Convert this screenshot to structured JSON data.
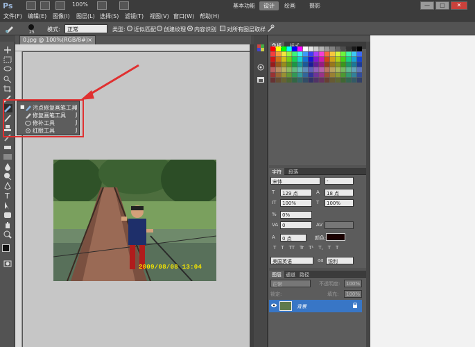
{
  "app": {
    "logo": "Ps"
  },
  "menubar": {
    "zoom": "100%",
    "workspaces": [
      "基本功能",
      "设计",
      "绘画",
      "摄影"
    ],
    "active_workspace": "设计",
    "window_buttons": [
      "—",
      "□",
      "✕"
    ],
    "menus": [
      "文件(F)",
      "编辑(E)",
      "图像(I)",
      "图层(L)",
      "选择(S)",
      "滤镜(T)",
      "视图(V)",
      "窗口(W)",
      "帮助(H)"
    ]
  },
  "options": {
    "brush_size": "25",
    "mode_label": "模式:",
    "mode_value": "正常",
    "type_label": "类型:",
    "type_options": [
      "近似匹配",
      "创建纹理",
      "内容识别"
    ],
    "sample_all_label": "对所有图层取样"
  },
  "document": {
    "tab_title": "0.jpg @ 100%(RGB/8#)",
    "tab_close": "×",
    "photo_date": "2009/08/08  13:04"
  },
  "flyout": {
    "items": [
      {
        "label": "污点修复画笔工具",
        "shortcut": "J",
        "active": true
      },
      {
        "label": "修复画笔工具",
        "shortcut": "J",
        "active": false
      },
      {
        "label": "修补工具",
        "shortcut": "J",
        "active": false
      },
      {
        "label": "红眼工具",
        "shortcut": "J",
        "active": false
      }
    ],
    "bullet": "■"
  },
  "panels": {
    "color_tabs": [
      "色板",
      "样式"
    ],
    "char_tabs": [
      "字符",
      "段落"
    ],
    "font_family": "宋体",
    "font_style": "-",
    "font_size": "129 点",
    "leading": "18 点",
    "vertical_scale": "100%",
    "horizontal_scale": "100%",
    "tsume": "0%",
    "tracking": "0",
    "baseline": "0 点",
    "color_label": "颜色:",
    "language": "美国英语",
    "antialias": "锐利",
    "aa_prefix": "aa",
    "type_buttons": [
      "T",
      "T",
      "TT",
      "Tr",
      "T¹",
      "T,",
      "T",
      "T"
    ],
    "layers_tabs": [
      "图层",
      "通道",
      "路径"
    ],
    "layer_mode": "正常",
    "opacity_label": "不透明度:",
    "opacity": "100%",
    "lock_label": "锁定:",
    "fill_label": "填充:",
    "fill": "100%",
    "layer_name": "背景"
  },
  "colors": {
    "accent_red": "#e03030",
    "selection_blue": "#3876c6",
    "date_yellow": "#f4e400"
  }
}
